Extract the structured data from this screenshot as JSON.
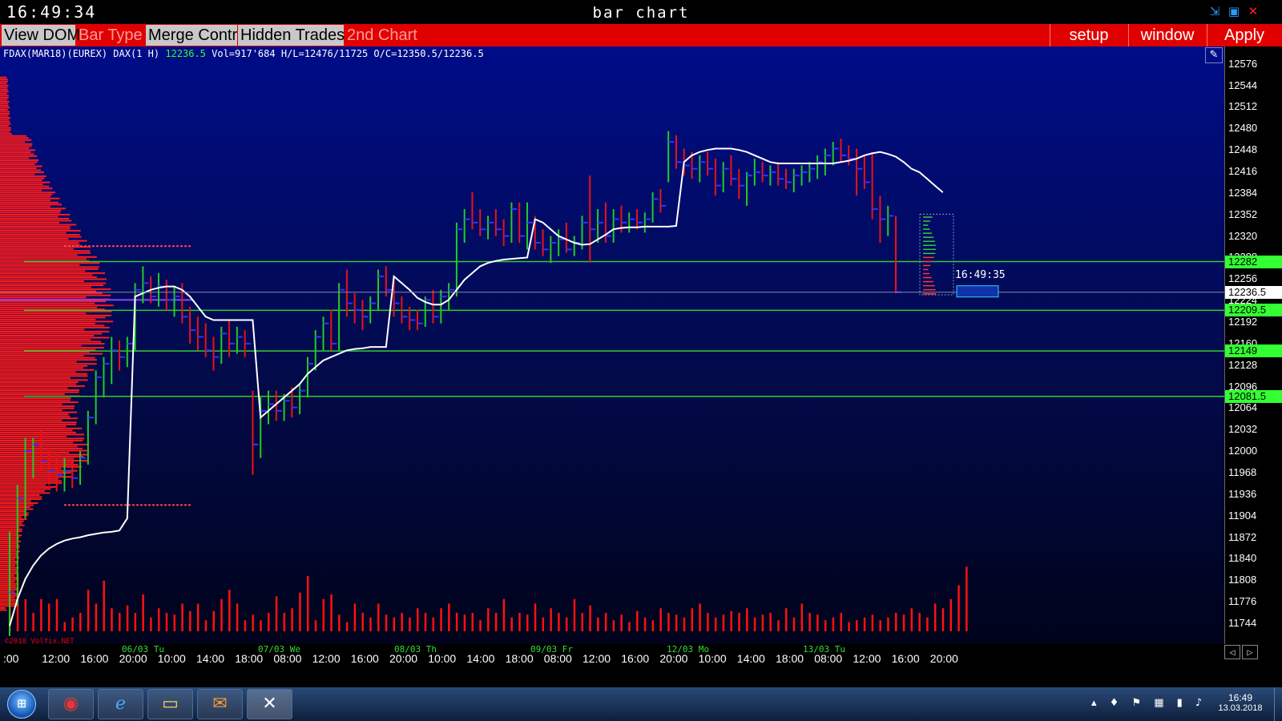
{
  "window": {
    "clock": "16:49:34",
    "title": "bar chart",
    "minimize_glyph": "⇲",
    "maximize_glyph": "▣",
    "close_glyph": "✕"
  },
  "toolbar": {
    "view_dom": "View DOM",
    "bar_type": "Bar Type",
    "merge_contr": "Merge Contr",
    "hidden_trades": "Hidden Trades",
    "second_chart": "2nd Chart",
    "setup": "setup",
    "window": "window",
    "apply": "Apply"
  },
  "info": {
    "symbol": "FDAX(MAR18)(EUREX) DAX(1 H)",
    "last": "12236.5",
    "stats": "Vol=917'684 H/L=12476/11725 O/C=12350.5/12236.5"
  },
  "colors": {
    "accent": "#e00000",
    "level_line": "#33cc33",
    "up_bar": "#22cc22",
    "down_bar": "#ee1111",
    "close_tick": "#3333ff",
    "moving_average": "#ffffff",
    "volume": "#ff1111"
  },
  "copyright": "©2018 Volfix.NET",
  "timer": "16:49:35",
  "icons": {
    "pencil": "pencil-icon",
    "layouts": "layout-icon",
    "expand": "expand-icon"
  },
  "y_axis": {
    "ticks": [
      "12576",
      "12544",
      "12512",
      "12480",
      "12448",
      "12416",
      "12384",
      "12352",
      "12320",
      "12288",
      "12256",
      "12224",
      "12192",
      "12160",
      "12128",
      "12096",
      "12064",
      "12032",
      "12000",
      "11968",
      "11936",
      "11904",
      "11872",
      "11840",
      "11808",
      "11776",
      "11744"
    ],
    "levels": [
      "12282",
      "12209.5",
      "12149",
      "12081.5"
    ],
    "current": "12236.5"
  },
  "x_axis": {
    "times": [
      ":00",
      "12:00",
      "16:00",
      "20:00",
      "10:00",
      "14:00",
      "18:00",
      "08:00",
      "12:00",
      "16:00",
      "20:00",
      "10:00",
      "14:00",
      "18:00",
      "08:00",
      "12:00",
      "16:00",
      "20:00",
      "10:00",
      "14:00",
      "18:00",
      "08:00",
      "12:00",
      "16:00",
      "20:00"
    ],
    "days": [
      "06/03 Tu",
      "07/03 We",
      "08/03 Th",
      "09/03 Fr",
      "12/03 Mo",
      "13/03 Tu"
    ]
  },
  "taskbar": {
    "time": "16:49",
    "date": "13.03.2018"
  },
  "chart_data": {
    "type": "ohlc",
    "ylim": [
      11725,
      12590
    ],
    "bar_interval": "1 H",
    "bars": [
      {
        "o": 11760,
        "h": 11880,
        "l": 11725,
        "c": 11790
      },
      {
        "o": 11790,
        "h": 11950,
        "l": 11770,
        "c": 11930
      },
      {
        "o": 11930,
        "h": 12020,
        "l": 11900,
        "c": 12000
      },
      {
        "o": 12000,
        "h": 12020,
        "l": 11960,
        "c": 12010
      },
      {
        "o": 12010,
        "h": 12030,
        "l": 11970,
        "c": 11985
      },
      {
        "o": 11985,
        "h": 12000,
        "l": 11950,
        "c": 11970
      },
      {
        "o": 11970,
        "h": 11995,
        "l": 11940,
        "c": 11965
      },
      {
        "o": 11965,
        "h": 11990,
        "l": 11940,
        "c": 11970
      },
      {
        "o": 11970,
        "h": 11985,
        "l": 11945,
        "c": 11960
      },
      {
        "o": 11960,
        "h": 12000,
        "l": 11950,
        "c": 11990
      },
      {
        "o": 11990,
        "h": 12060,
        "l": 11980,
        "c": 12050
      },
      {
        "o": 12050,
        "h": 12120,
        "l": 12040,
        "c": 12110
      },
      {
        "o": 12110,
        "h": 12140,
        "l": 12080,
        "c": 12130
      },
      {
        "o": 12130,
        "h": 12170,
        "l": 12100,
        "c": 12150
      },
      {
        "o": 12150,
        "h": 12165,
        "l": 12120,
        "c": 12140
      },
      {
        "o": 12140,
        "h": 12170,
        "l": 12125,
        "c": 12160
      },
      {
        "o": 12160,
        "h": 12250,
        "l": 12150,
        "c": 12240
      },
      {
        "o": 12240,
        "h": 12275,
        "l": 12220,
        "c": 12250
      },
      {
        "o": 12250,
        "h": 12260,
        "l": 12220,
        "c": 12230
      },
      {
        "o": 12230,
        "h": 12265,
        "l": 12215,
        "c": 12245
      },
      {
        "o": 12245,
        "h": 12255,
        "l": 12210,
        "c": 12225
      },
      {
        "o": 12225,
        "h": 12245,
        "l": 12200,
        "c": 12230
      },
      {
        "o": 12230,
        "h": 12250,
        "l": 12190,
        "c": 12200
      },
      {
        "o": 12200,
        "h": 12215,
        "l": 12160,
        "c": 12180
      },
      {
        "o": 12180,
        "h": 12200,
        "l": 12150,
        "c": 12170
      },
      {
        "o": 12170,
        "h": 12190,
        "l": 12140,
        "c": 12150
      },
      {
        "o": 12150,
        "h": 12170,
        "l": 12120,
        "c": 12140
      },
      {
        "o": 12140,
        "h": 12185,
        "l": 12130,
        "c": 12175
      },
      {
        "o": 12175,
        "h": 12195,
        "l": 12140,
        "c": 12160
      },
      {
        "o": 12160,
        "h": 12185,
        "l": 12145,
        "c": 12170
      },
      {
        "o": 12170,
        "h": 12180,
        "l": 12140,
        "c": 12160
      },
      {
        "o": 12080,
        "h": 12090,
        "l": 11965,
        "c": 12010
      },
      {
        "o": 12010,
        "h": 12080,
        "l": 11990,
        "c": 12060
      },
      {
        "o": 12060,
        "h": 12090,
        "l": 12040,
        "c": 12070
      },
      {
        "o": 12070,
        "h": 12090,
        "l": 12045,
        "c": 12060
      },
      {
        "o": 12060,
        "h": 12085,
        "l": 12045,
        "c": 12075
      },
      {
        "o": 12075,
        "h": 12095,
        "l": 12050,
        "c": 12065
      },
      {
        "o": 12065,
        "h": 12100,
        "l": 12055,
        "c": 12090
      },
      {
        "o": 12090,
        "h": 12140,
        "l": 12080,
        "c": 12130
      },
      {
        "o": 12130,
        "h": 12180,
        "l": 12120,
        "c": 12170
      },
      {
        "o": 12170,
        "h": 12200,
        "l": 12150,
        "c": 12190
      },
      {
        "o": 12190,
        "h": 12210,
        "l": 12150,
        "c": 12160
      },
      {
        "o": 12160,
        "h": 12250,
        "l": 12150,
        "c": 12240
      },
      {
        "o": 12240,
        "h": 12270,
        "l": 12200,
        "c": 12220
      },
      {
        "o": 12220,
        "h": 12235,
        "l": 12190,
        "c": 12210
      },
      {
        "o": 12210,
        "h": 12225,
        "l": 12180,
        "c": 12200
      },
      {
        "o": 12200,
        "h": 12230,
        "l": 12190,
        "c": 12220
      },
      {
        "o": 12220,
        "h": 12270,
        "l": 12210,
        "c": 12260
      },
      {
        "o": 12260,
        "h": 12275,
        "l": 12230,
        "c": 12240
      },
      {
        "o": 12240,
        "h": 12260,
        "l": 12200,
        "c": 12220
      },
      {
        "o": 12220,
        "h": 12230,
        "l": 12190,
        "c": 12200
      },
      {
        "o": 12200,
        "h": 12215,
        "l": 12180,
        "c": 12195
      },
      {
        "o": 12195,
        "h": 12210,
        "l": 12180,
        "c": 12190
      },
      {
        "o": 12190,
        "h": 12230,
        "l": 12185,
        "c": 12225
      },
      {
        "o": 12225,
        "h": 12240,
        "l": 12190,
        "c": 12200
      },
      {
        "o": 12200,
        "h": 12240,
        "l": 12190,
        "c": 12230
      },
      {
        "o": 12230,
        "h": 12250,
        "l": 12210,
        "c": 12240
      },
      {
        "o": 12240,
        "h": 12340,
        "l": 12230,
        "c": 12330
      },
      {
        "o": 12330,
        "h": 12360,
        "l": 12310,
        "c": 12345
      },
      {
        "o": 12345,
        "h": 12385,
        "l": 12330,
        "c": 12340
      },
      {
        "o": 12340,
        "h": 12360,
        "l": 12320,
        "c": 12330
      },
      {
        "o": 12330,
        "h": 12350,
        "l": 12315,
        "c": 12340
      },
      {
        "o": 12340,
        "h": 12360,
        "l": 12320,
        "c": 12330
      },
      {
        "o": 12330,
        "h": 12345,
        "l": 12305,
        "c": 12320
      },
      {
        "o": 12320,
        "h": 12370,
        "l": 12310,
        "c": 12360
      },
      {
        "o": 12360,
        "h": 12370,
        "l": 12310,
        "c": 12320
      },
      {
        "o": 12320,
        "h": 12370,
        "l": 12300,
        "c": 12340
      },
      {
        "o": 12340,
        "h": 12350,
        "l": 12300,
        "c": 12310
      },
      {
        "o": 12310,
        "h": 12330,
        "l": 12290,
        "c": 12300
      },
      {
        "o": 12300,
        "h": 12320,
        "l": 12280,
        "c": 12310
      },
      {
        "o": 12310,
        "h": 12330,
        "l": 12290,
        "c": 12315
      },
      {
        "o": 12315,
        "h": 12340,
        "l": 12295,
        "c": 12300
      },
      {
        "o": 12300,
        "h": 12320,
        "l": 12290,
        "c": 12310
      },
      {
        "o": 12310,
        "h": 12350,
        "l": 12300,
        "c": 12340
      },
      {
        "o": 12340,
        "h": 12410,
        "l": 12280,
        "c": 12330
      },
      {
        "o": 12330,
        "h": 12360,
        "l": 12310,
        "c": 12340
      },
      {
        "o": 12340,
        "h": 12370,
        "l": 12310,
        "c": 12320
      },
      {
        "o": 12320,
        "h": 12360,
        "l": 12310,
        "c": 12345
      },
      {
        "o": 12345,
        "h": 12365,
        "l": 12325,
        "c": 12340
      },
      {
        "o": 12340,
        "h": 12355,
        "l": 12325,
        "c": 12345
      },
      {
        "o": 12345,
        "h": 12360,
        "l": 12330,
        "c": 12340
      },
      {
        "o": 12340,
        "h": 12355,
        "l": 12325,
        "c": 12345
      },
      {
        "o": 12345,
        "h": 12385,
        "l": 12340,
        "c": 12375
      },
      {
        "o": 12375,
        "h": 12390,
        "l": 12355,
        "c": 12365
      },
      {
        "o": 12420,
        "h": 12476,
        "l": 12400,
        "c": 12460
      },
      {
        "o": 12460,
        "h": 12470,
        "l": 12420,
        "c": 12430
      },
      {
        "o": 12430,
        "h": 12450,
        "l": 12410,
        "c": 12425
      },
      {
        "o": 12425,
        "h": 12445,
        "l": 12405,
        "c": 12420
      },
      {
        "o": 12420,
        "h": 12440,
        "l": 12400,
        "c": 12430
      },
      {
        "o": 12430,
        "h": 12445,
        "l": 12410,
        "c": 12420
      },
      {
        "o": 12420,
        "h": 12435,
        "l": 12380,
        "c": 12395
      },
      {
        "o": 12395,
        "h": 12430,
        "l": 12385,
        "c": 12420
      },
      {
        "o": 12420,
        "h": 12440,
        "l": 12395,
        "c": 12405
      },
      {
        "o": 12405,
        "h": 12420,
        "l": 12375,
        "c": 12395
      },
      {
        "o": 12395,
        "h": 12415,
        "l": 12365,
        "c": 12410
      },
      {
        "o": 12410,
        "h": 12435,
        "l": 12395,
        "c": 12415
      },
      {
        "o": 12415,
        "h": 12430,
        "l": 12400,
        "c": 12410
      },
      {
        "o": 12410,
        "h": 12425,
        "l": 12395,
        "c": 12415
      },
      {
        "o": 12415,
        "h": 12430,
        "l": 12395,
        "c": 12405
      },
      {
        "o": 12405,
        "h": 12420,
        "l": 12390,
        "c": 12400
      },
      {
        "o": 12400,
        "h": 12420,
        "l": 12385,
        "c": 12410
      },
      {
        "o": 12410,
        "h": 12425,
        "l": 12395,
        "c": 12415
      },
      {
        "o": 12415,
        "h": 12430,
        "l": 12400,
        "c": 12420
      },
      {
        "o": 12420,
        "h": 12440,
        "l": 12405,
        "c": 12430
      },
      {
        "o": 12430,
        "h": 12450,
        "l": 12410,
        "c": 12440
      },
      {
        "o": 12440,
        "h": 12460,
        "l": 12425,
        "c": 12450
      },
      {
        "o": 12450,
        "h": 12465,
        "l": 12430,
        "c": 12440
      },
      {
        "o": 12440,
        "h": 12455,
        "l": 12425,
        "c": 12435
      },
      {
        "o": 12435,
        "h": 12450,
        "l": 12380,
        "c": 12420
      },
      {
        "o": 12420,
        "h": 12440,
        "l": 12390,
        "c": 12400
      },
      {
        "o": 12400,
        "h": 12445,
        "l": 12345,
        "c": 12360
      },
      {
        "o": 12360,
        "h": 12380,
        "l": 12310,
        "c": 12345
      },
      {
        "o": 12345,
        "h": 12365,
        "l": 12320,
        "c": 12350
      },
      {
        "o": 12350,
        "h": 12350,
        "l": 12235,
        "c": 12236.5
      }
    ],
    "moving_average": [
      11740,
      11780,
      11810,
      11830,
      11845,
      11855,
      11862,
      11867,
      11870,
      11872,
      11875,
      11877,
      11879,
      11880,
      11882,
      11900,
      12230,
      12235,
      12240,
      12243,
      12245,
      12245,
      12240,
      12230,
      12215,
      12200,
      12195,
      12195,
      12195,
      12195,
      12195,
      12195,
      12050,
      12060,
      12070,
      12080,
      12090,
      12100,
      12115,
      12125,
      12135,
      12140,
      12145,
      12150,
      12152,
      12153,
      12155,
      12155,
      12155,
      12260,
      12250,
      12240,
      12228,
      12222,
      12218,
      12218,
      12225,
      12240,
      12255,
      12265,
      12275,
      12280,
      12283,
      12285,
      12286,
      12287,
      12288,
      12345,
      12340,
      12330,
      12320,
      12315,
      12310,
      12307,
      12308,
      12315,
      12322,
      12330,
      12332,
      12333,
      12333,
      12334,
      12334,
      12334,
      12334,
      12335,
      12430,
      12440,
      12445,
      12448,
      12450,
      12450,
      12450,
      12448,
      12445,
      12440,
      12435,
      12430,
      12428,
      12428,
      12428,
      12428,
      12428,
      12428,
      12428,
      12428,
      12430,
      12432,
      12435,
      12440,
      12443,
      12445,
      12442,
      12438,
      12430,
      12420,
      12415,
      12405,
      12395,
      12385
    ],
    "volume": [
      0.55,
      0.62,
      0.35,
      0.2,
      0.35,
      0.3,
      0.35,
      0.1,
      0.15,
      0.2,
      0.45,
      0.3,
      0.55,
      0.25,
      0.2,
      0.28,
      0.2,
      0.4,
      0.15,
      0.25,
      0.2,
      0.18,
      0.3,
      0.22,
      0.3,
      0.12,
      0.22,
      0.35,
      0.45,
      0.3,
      0.12,
      0.18,
      0.12,
      0.2,
      0.38,
      0.2,
      0.25,
      0.42,
      0.6,
      0.12,
      0.35,
      0.4,
      0.18,
      0.1,
      0.3,
      0.2,
      0.15,
      0.3,
      0.18,
      0.15,
      0.2,
      0.15,
      0.25,
      0.2,
      0.15,
      0.25,
      0.3,
      0.2,
      0.18,
      0.2,
      0.12,
      0.25,
      0.2,
      0.35,
      0.15,
      0.2,
      0.18,
      0.3,
      0.15,
      0.25,
      0.2,
      0.15,
      0.35,
      0.2,
      0.28,
      0.15,
      0.2,
      0.12,
      0.18,
      0.1,
      0.22,
      0.15,
      0.12,
      0.25,
      0.2,
      0.18,
      0.15,
      0.25,
      0.3,
      0.2,
      0.15,
      0.18,
      0.22,
      0.2,
      0.25,
      0.15,
      0.18,
      0.2,
      0.12,
      0.25,
      0.15,
      0.3,
      0.2,
      0.18,
      0.12,
      0.15,
      0.2,
      0.1,
      0.12,
      0.15,
      0.18,
      0.12,
      0.15,
      0.2,
      0.18,
      0.25,
      0.2,
      0.15,
      0.3,
      0.25,
      0.35,
      0.5,
      0.7
    ],
    "levels": [
      12282,
      12209.5,
      12149,
      12081.5
    ],
    "current_price": 12236.5
  }
}
